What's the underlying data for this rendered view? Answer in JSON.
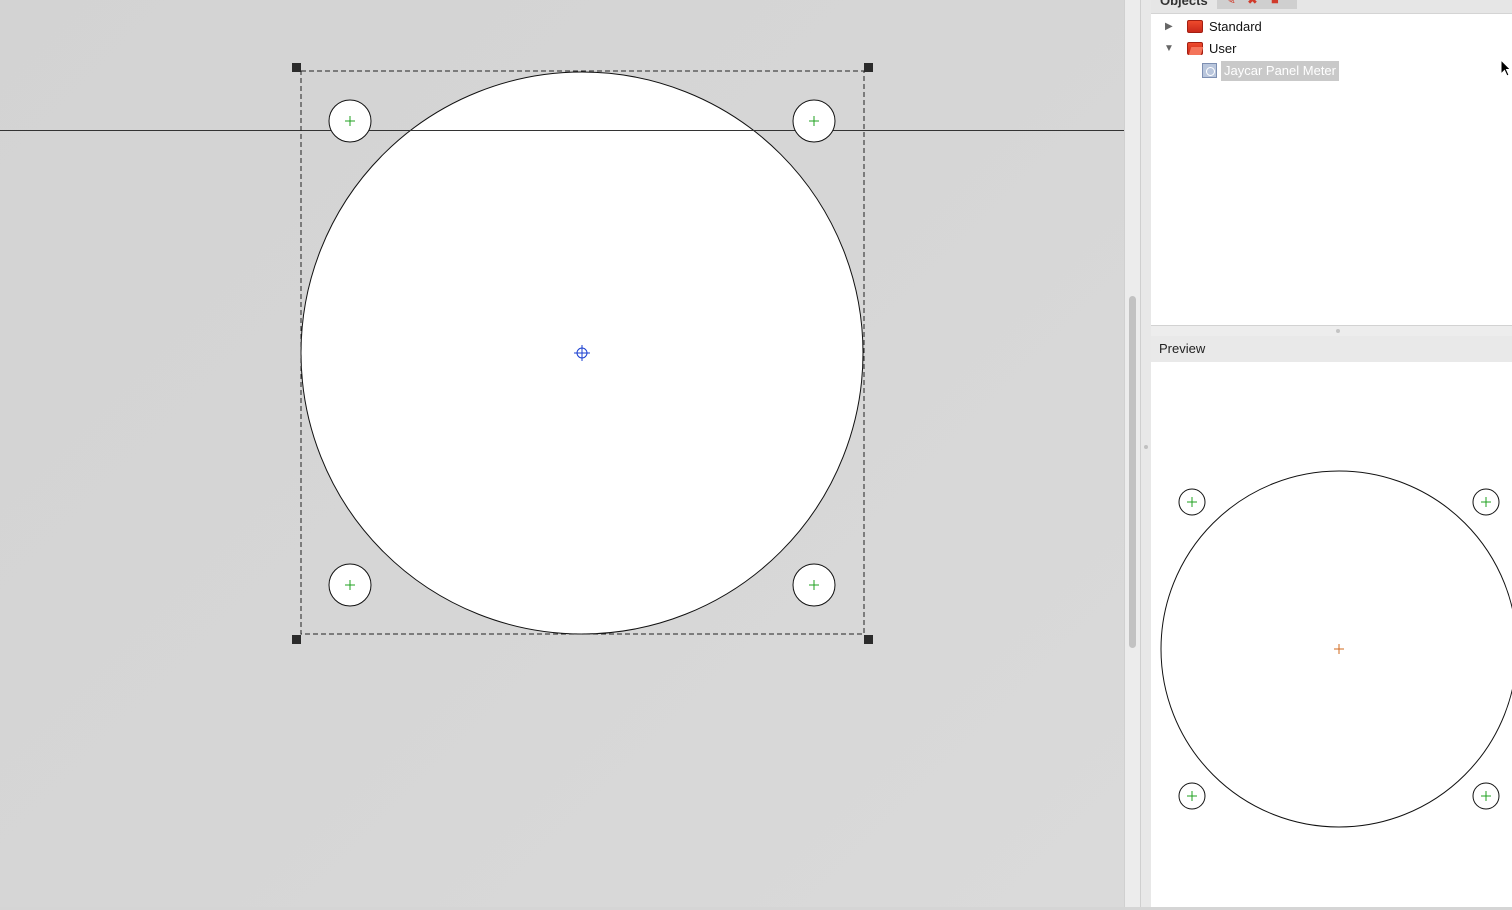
{
  "canvas": {
    "background": "#d5d5d5",
    "handle_color": "#2b2b2b",
    "mount_hole_color": "#1fa21f",
    "center_marker_color": "#1a3fd0"
  },
  "objects_panel": {
    "title": "Objects",
    "tree": [
      {
        "label": "Standard",
        "expanded": false,
        "icon": "folder-icon"
      },
      {
        "label": "User",
        "expanded": true,
        "icon": "folder-open-icon",
        "children": [
          {
            "label": "Jaycar Panel Meter",
            "selected": true,
            "icon": "panel-meter-icon"
          }
        ]
      }
    ],
    "accent": "#d03a2a"
  },
  "preview_panel": {
    "title": "Preview",
    "center_marker_color": "#d2691e",
    "mount_hole_color": "#1fa21f"
  }
}
